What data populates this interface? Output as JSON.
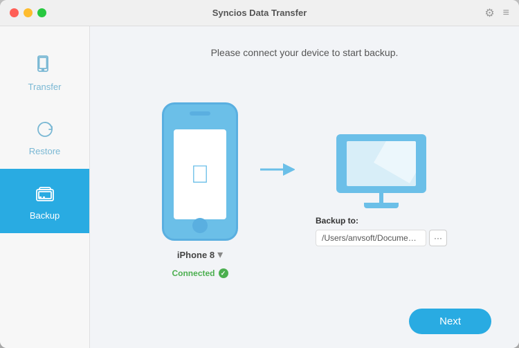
{
  "window": {
    "title": "Syncios Data Transfer"
  },
  "titlebar": {
    "gear_icon": "⚙",
    "menu_icon": "≡"
  },
  "sidebar": {
    "items": [
      {
        "id": "transfer",
        "label": "Transfer",
        "icon": "transfer"
      },
      {
        "id": "restore",
        "label": "Restore",
        "icon": "restore"
      },
      {
        "id": "backup",
        "label": "Backup",
        "icon": "backup",
        "active": true
      }
    ]
  },
  "content": {
    "heading": "Please connect your device to start backup.",
    "source_device": {
      "name": "iPhone 8",
      "status": "Connected"
    },
    "arrow_direction": "right",
    "backup": {
      "label": "Backup to:",
      "path": "/Users/anvsoft/Document...",
      "browse_btn": "···"
    }
  },
  "footer": {
    "next_label": "Next"
  }
}
